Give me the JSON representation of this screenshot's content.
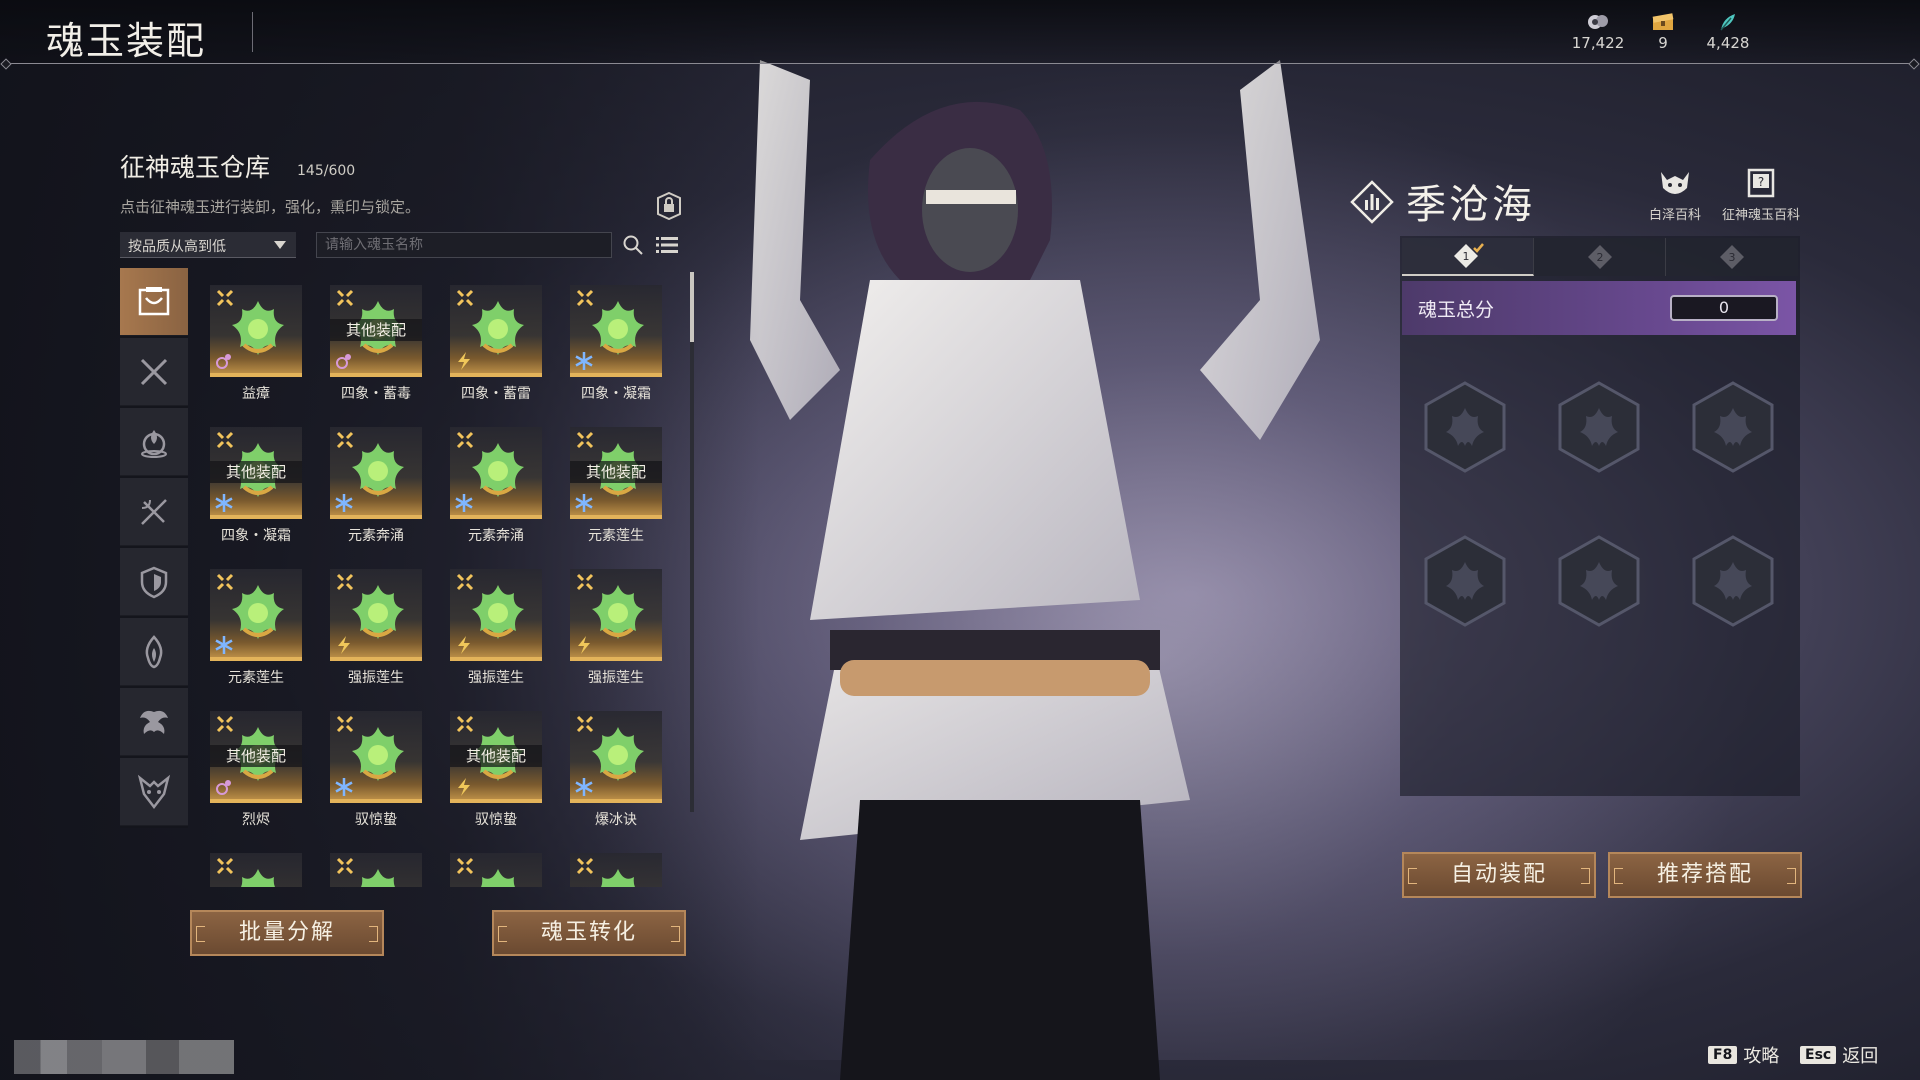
{
  "header": {
    "title": "魂玉装配",
    "currencies": [
      {
        "icon": "spirit-coin-icon",
        "value": "17,422"
      },
      {
        "icon": "treasure-chest-icon",
        "value": "9"
      },
      {
        "icon": "feather-icon",
        "value": "4,428"
      }
    ]
  },
  "warehouse": {
    "title": "征神魂玉仓库",
    "count": "145/600",
    "hint": "点击征神魂玉进行装卸，强化，熏印与锁定。",
    "sort_label": "按品质从高到低",
    "search_placeholder": "请输入魂玉名称",
    "categories": [
      "jade-all-icon",
      "crossed-swords-icon",
      "flame-orb-icon",
      "crossed-bows-icon",
      "shield-icon",
      "fire-icon",
      "phoenix-icon",
      "demon-mask-icon"
    ],
    "items": [
      {
        "name": "益瘴",
        "equipped": "",
        "element": "mix"
      },
      {
        "name": "四象・蓄毒",
        "equipped": "其他装配",
        "element": "mix"
      },
      {
        "name": "四象・蓄雷",
        "equipped": "",
        "element": "thunder"
      },
      {
        "name": "四象・凝霜",
        "equipped": "",
        "element": "frost"
      },
      {
        "name": "四象・凝霜",
        "equipped": "其他装配",
        "element": "frost"
      },
      {
        "name": "元素奔涌",
        "equipped": "",
        "element": "frost"
      },
      {
        "name": "元素奔涌",
        "equipped": "",
        "element": "frost"
      },
      {
        "name": "元素莲生",
        "equipped": "其他装配",
        "element": "frost"
      },
      {
        "name": "元素莲生",
        "equipped": "",
        "element": "frost"
      },
      {
        "name": "强振莲生",
        "equipped": "",
        "element": "thunder"
      },
      {
        "name": "强振莲生",
        "equipped": "",
        "element": "thunder"
      },
      {
        "name": "强振莲生",
        "equipped": "",
        "element": "thunder"
      },
      {
        "name": "烈烬",
        "equipped": "其他装配",
        "element": "mix"
      },
      {
        "name": "驭惊蛰",
        "equipped": "",
        "element": "frost"
      },
      {
        "name": "驭惊蛰",
        "equipped": "其他装配",
        "element": "thunder"
      },
      {
        "name": "爆冰诀",
        "equipped": "",
        "element": "frost"
      },
      {
        "name": "",
        "equipped": "",
        "element": "none"
      },
      {
        "name": "",
        "equipped": "",
        "element": "none"
      },
      {
        "name": "",
        "equipped": "",
        "element": "none"
      },
      {
        "name": "",
        "equipped": "",
        "element": "none"
      }
    ],
    "batch_decompose": "批量分解",
    "jade_convert": "魂玉转化"
  },
  "character": {
    "name": "季沧海",
    "encyclopedia_1": "白泽百科",
    "encyclopedia_2": "征神魂玉百科",
    "tabs": [
      "1",
      "2",
      "3"
    ],
    "score_label": "魂玉总分",
    "score_value": "0",
    "auto_equip": "自动装配",
    "recommend": "推荐搭配"
  },
  "footer": {
    "guide_key": "F8",
    "guide_label": "攻略",
    "back_key": "Esc",
    "back_label": "返回"
  },
  "colors": {
    "accent_brown": "#8c6443",
    "score_purple": "#6a4a92",
    "gold_stripe": "#e3b35a",
    "frost_blue": "#7fb6ff",
    "thunder_gold": "#f0c75a",
    "mix_pink": "#d79ad8"
  }
}
